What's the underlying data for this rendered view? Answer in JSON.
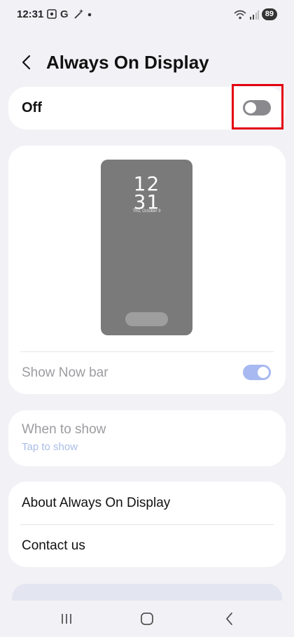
{
  "status_bar": {
    "time": "12:31",
    "battery": "89"
  },
  "header": {
    "title": "Always On Display"
  },
  "master_toggle": {
    "label": "Off",
    "state": "off"
  },
  "preview": {
    "clock_hour": "12",
    "clock_minute": "31",
    "date": "Thu, October 9"
  },
  "show_now_bar": {
    "label": "Show Now bar",
    "state": "on"
  },
  "when_to_show": {
    "label": "When to show",
    "value": "Tap to show"
  },
  "about": {
    "about_label": "About Always On Display",
    "contact_label": "Contact us"
  },
  "colors": {
    "highlight": "#e3000f",
    "toggle_on": "#a7b9f0",
    "toggle_off": "#8a8a8e",
    "accent_sub": "#a9bde6"
  }
}
